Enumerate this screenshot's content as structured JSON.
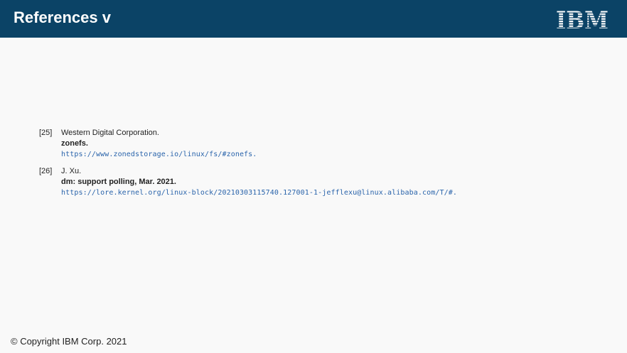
{
  "header": {
    "title": "References v",
    "logo_text": "IBM",
    "background_color": "#0b4366"
  },
  "references": [
    {
      "number": "[25]",
      "author": "Western Digital Corporation.",
      "title": "zonefs.",
      "url": "https://www.zonedstorage.io/linux/fs/#zonefs."
    },
    {
      "number": "[26]",
      "author": "J. Xu.",
      "title": "dm: support polling, Mar. 2021.",
      "url": "https://lore.kernel.org/linux-block/20210303115740.127001-1-jefflexu@linux.alibaba.com/T/#."
    }
  ],
  "footer": {
    "copyright": "© Copyright IBM Corp. 2021"
  },
  "colors": {
    "link": "#2a64ab",
    "text": "#222222",
    "page_background": "#f9f9f9"
  }
}
